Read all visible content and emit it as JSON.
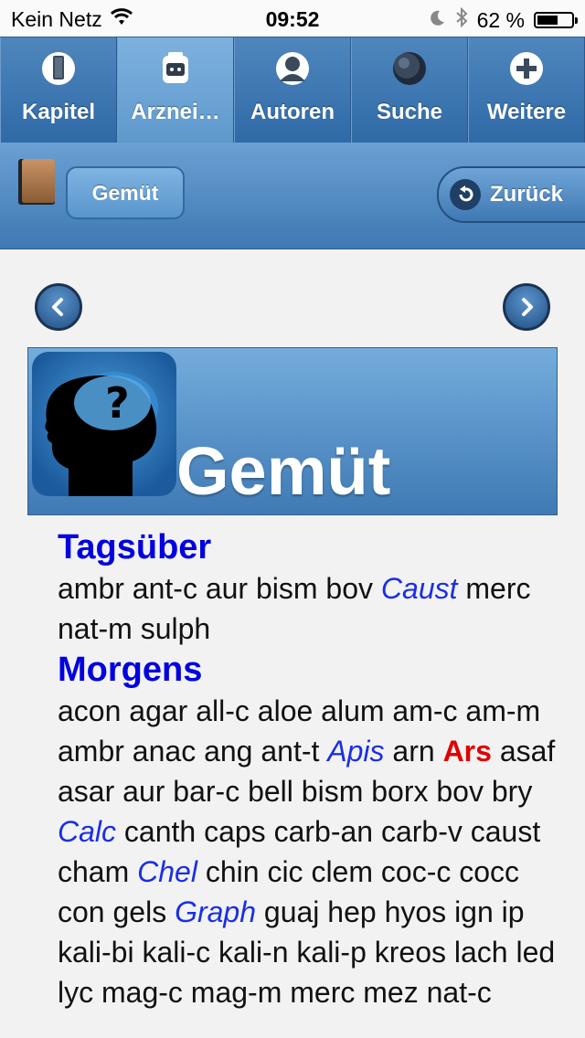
{
  "status": {
    "carrier": "Kein Netz",
    "time": "09:52",
    "battery": "62 %",
    "battery_level": 0.62
  },
  "tabs": [
    {
      "label": "Kapitel",
      "icon": "book-icon",
      "active": false
    },
    {
      "label": "Arznei…",
      "icon": "medicine-icon",
      "active": true
    },
    {
      "label": "Autoren",
      "icon": "person-icon",
      "active": false
    },
    {
      "label": "Suche",
      "icon": "search-icon",
      "active": false
    },
    {
      "label": "Weitere",
      "icon": "plus-icon",
      "active": false
    }
  ],
  "nav": {
    "chapter_button": "Gemüt",
    "back_button": "Zurück"
  },
  "header": {
    "title": "Gemüt",
    "icon": "head-question-icon"
  },
  "content": {
    "sections": [
      {
        "title": "Tagsüber",
        "items": [
          {
            "text": "ambr"
          },
          {
            "text": "ant-c"
          },
          {
            "text": "aur"
          },
          {
            "text": "bism"
          },
          {
            "text": "bov"
          },
          {
            "text": "Caust",
            "style": "italic"
          },
          {
            "text": "merc"
          },
          {
            "text": "nat-m"
          },
          {
            "text": "sulph"
          }
        ]
      },
      {
        "title": "Morgens",
        "items": [
          {
            "text": "acon"
          },
          {
            "text": "agar"
          },
          {
            "text": "all-c"
          },
          {
            "text": "aloe"
          },
          {
            "text": "alum"
          },
          {
            "text": "am-c"
          },
          {
            "text": "am-m"
          },
          {
            "text": "ambr"
          },
          {
            "text": "anac"
          },
          {
            "text": "ang"
          },
          {
            "text": "ant-t"
          },
          {
            "text": "Apis",
            "style": "italic"
          },
          {
            "text": "arn"
          },
          {
            "text": "Ars",
            "style": "bold-red"
          },
          {
            "text": "asaf"
          },
          {
            "text": "asar"
          },
          {
            "text": "aur"
          },
          {
            "text": "bar-c"
          },
          {
            "text": "bell"
          },
          {
            "text": "bism"
          },
          {
            "text": "borx"
          },
          {
            "text": "bov"
          },
          {
            "text": "bry"
          },
          {
            "text": "Calc",
            "style": "italic"
          },
          {
            "text": "canth"
          },
          {
            "text": "caps"
          },
          {
            "text": "carb-an"
          },
          {
            "text": "carb-v"
          },
          {
            "text": "caust"
          },
          {
            "text": "cham"
          },
          {
            "text": "Chel",
            "style": "italic"
          },
          {
            "text": "chin"
          },
          {
            "text": "cic"
          },
          {
            "text": "clem"
          },
          {
            "text": "coc-c"
          },
          {
            "text": "cocc"
          },
          {
            "text": "con"
          },
          {
            "text": "gels"
          },
          {
            "text": "Graph",
            "style": "italic"
          },
          {
            "text": "guaj"
          },
          {
            "text": "hep"
          },
          {
            "text": "hyos"
          },
          {
            "text": "ign"
          },
          {
            "text": "ip"
          },
          {
            "text": "kali-bi"
          },
          {
            "text": "kali-c"
          },
          {
            "text": "kali-n"
          },
          {
            "text": "kali-p"
          },
          {
            "text": "kreos"
          },
          {
            "text": "lach"
          },
          {
            "text": "led"
          },
          {
            "text": "lyc"
          },
          {
            "text": "mag-c"
          },
          {
            "text": "mag-m"
          },
          {
            "text": "merc"
          },
          {
            "text": "mez"
          },
          {
            "text": "nat-c"
          }
        ]
      }
    ]
  },
  "colors": {
    "accent": "#3f78b3",
    "section_title": "#0000e0",
    "italic_remedy": "#1a2ee8",
    "bold_remedy": "#e00000"
  }
}
